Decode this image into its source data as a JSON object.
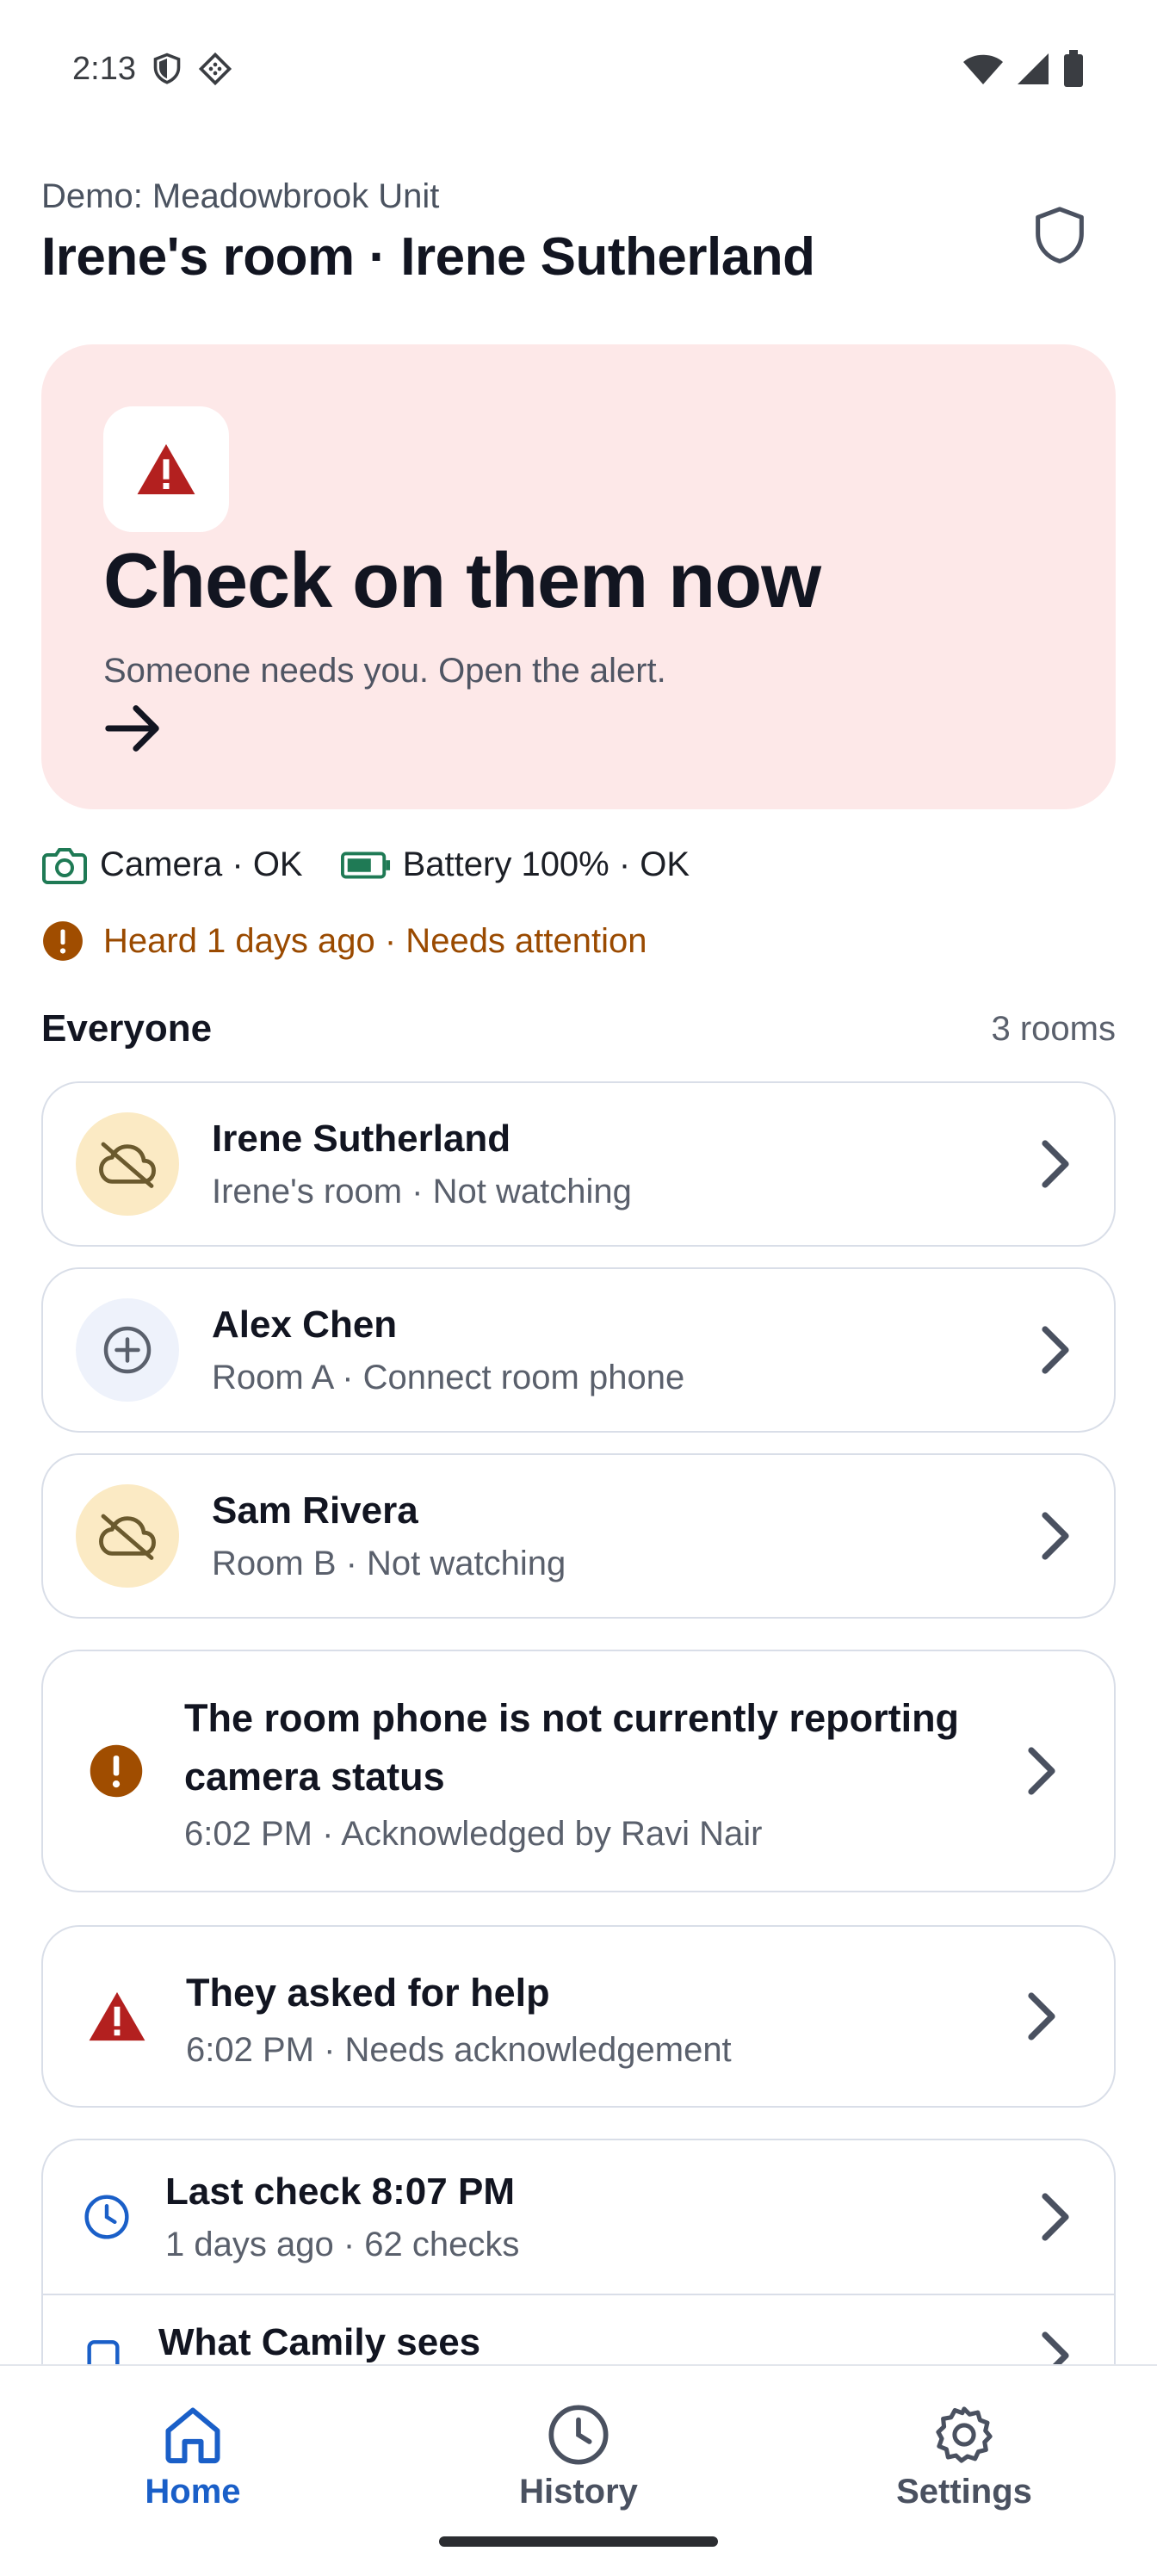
{
  "statusbar": {
    "time": "2:13"
  },
  "header": {
    "unit": "Demo: Meadowbrook Unit",
    "title": "Irene's room · Irene Sutherland"
  },
  "alert": {
    "title": "Check on them now",
    "subtitle": "Someone needs you. Open the alert."
  },
  "device_status": {
    "camera": "Camera · OK",
    "battery": "Battery 100% · OK",
    "heard": "Heard 1 days ago · Needs attention"
  },
  "everyone": {
    "title": "Everyone",
    "count": "3 rooms",
    "people": [
      {
        "name": "Irene Sutherland",
        "sub": "Irene's room · Not watching",
        "icon": "cloud-off-icon"
      },
      {
        "name": "Alex Chen",
        "sub": "Room A · Connect room phone",
        "icon": "add-circle-icon"
      },
      {
        "name": "Sam Rivera",
        "sub": "Room B · Not watching",
        "icon": "cloud-off-icon"
      }
    ]
  },
  "events": [
    {
      "title": "The room phone is not currently reporting camera status",
      "sub": "6:02 PM · Acknowledged by Ravi Nair",
      "icon": "warning-circle-icon"
    },
    {
      "title": "They asked for help",
      "sub": "6:02 PM · Needs acknowledgement",
      "icon": "alert-triangle-icon"
    }
  ],
  "checks": {
    "last_check_title": "Last check 8:07 PM",
    "last_check_sub": "1 days ago · 62 checks",
    "sees_title": "What Camily sees"
  },
  "nav": {
    "home": "Home",
    "history": "History",
    "settings": "Settings"
  },
  "colors": {
    "accent": "#1a5fc8",
    "alert_bg": "#fde8e8",
    "danger": "#b3201f",
    "warning": "#9a4a00",
    "ok": "#1f7a55"
  }
}
